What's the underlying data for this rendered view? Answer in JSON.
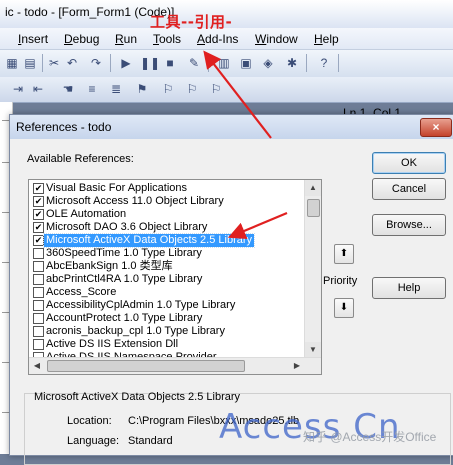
{
  "window": {
    "title": "ic - todo - [Form_Form1 (Code)]"
  },
  "annotation": {
    "text": "工具--引用-",
    "color": "#e02020"
  },
  "menu": [
    {
      "label": "Insert",
      "u": "I"
    },
    {
      "label": "Debug",
      "u": "D"
    },
    {
      "label": "Run",
      "u": "R"
    },
    {
      "label": "Tools",
      "u": "T"
    },
    {
      "label": "Add-Ins",
      "u": "A"
    },
    {
      "label": "Window",
      "u": "W"
    },
    {
      "label": "Help",
      "u": "H"
    }
  ],
  "toolbar": {
    "position": "Ln 1, Col 1"
  },
  "dialog": {
    "title": "References - todo",
    "close": "×",
    "available_label": "Available References:",
    "references": [
      {
        "label": "Visual Basic For Applications",
        "checked": true,
        "selected": false
      },
      {
        "label": "Microsoft Access 11.0 Object Library",
        "checked": true,
        "selected": false
      },
      {
        "label": "OLE Automation",
        "checked": true,
        "selected": false
      },
      {
        "label": "Microsoft DAO 3.6 Object Library",
        "checked": true,
        "selected": false
      },
      {
        "label": "Microsoft ActiveX Data Objects 2.5 Library",
        "checked": true,
        "selected": true
      },
      {
        "label": "360SpeedTime 1.0 Type Library",
        "checked": false,
        "selected": false
      },
      {
        "label": "AbcEbankSign 1.0 类型库",
        "checked": false,
        "selected": false
      },
      {
        "label": "abcPrintCtl4RA 1.0 Type Library",
        "checked": false,
        "selected": false
      },
      {
        "label": "Access_Score",
        "checked": false,
        "selected": false
      },
      {
        "label": "AccessibilityCplAdmin 1.0 Type Library",
        "checked": false,
        "selected": false
      },
      {
        "label": "AccountProtect 1.0 Type Library",
        "checked": false,
        "selected": false
      },
      {
        "label": "acronis_backup_cpl 1.0 Type Library",
        "checked": false,
        "selected": false
      },
      {
        "label": "Active DS IIS Extension Dll",
        "checked": false,
        "selected": false
      },
      {
        "label": "Active DS IIS Namespace Provider",
        "checked": false,
        "selected": false
      }
    ],
    "buttons": {
      "ok": "OK",
      "cancel": "Cancel",
      "browse": "Browse...",
      "help": "Help"
    },
    "priority_label": "Priority",
    "details": {
      "name": "Microsoft ActiveX Data Objects 2.5 Library",
      "location_label": "Location:",
      "location_value": "C:\\Program Files\\bxxx\\msado25.tlb",
      "language_label": "Language:",
      "language_value": "Standard"
    }
  },
  "watermark": {
    "brand": "Access Cn",
    "zh": "知乎 @Access开发Office"
  }
}
